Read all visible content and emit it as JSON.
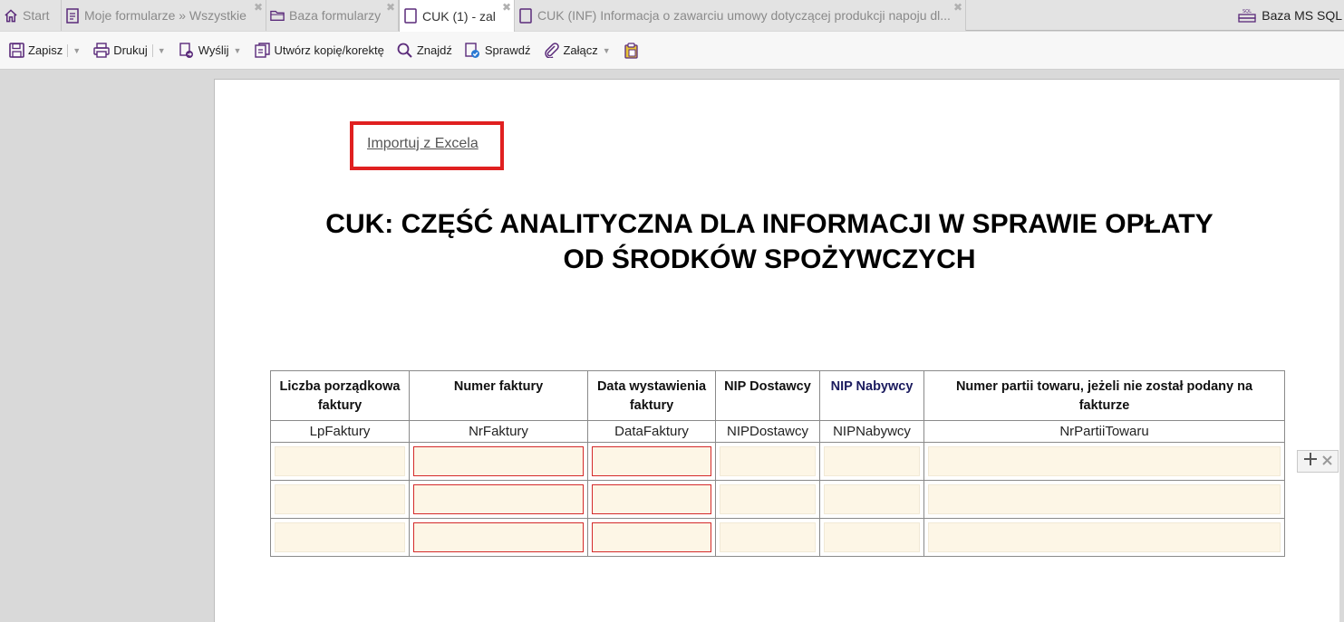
{
  "tabs": [
    {
      "label": "Start",
      "icon": "home-icon"
    },
    {
      "label": "Moje formularze » Wszystkie",
      "icon": "document-icon"
    },
    {
      "label": "Baza formularzy",
      "icon": "folder-icon"
    },
    {
      "label": "CUK (1) - zal",
      "icon": "page-icon"
    },
    {
      "label": "CUK (INF) Informacja o zawarciu umowy dotyczącej produkcji napoju dl...",
      "icon": "page-icon"
    }
  ],
  "db_tab": {
    "label": "Baza MS SQL",
    "icon": "database-icon"
  },
  "toolbar": {
    "save": "Zapisz",
    "print": "Drukuj",
    "send": "Wyślij",
    "copy": "Utwórz kopię/korektę",
    "find": "Znajdź",
    "check": "Sprawdź",
    "attach": "Załącz"
  },
  "document": {
    "import_link": "Importuj z Excela",
    "title_line1": "CUK: CZĘŚĆ ANALITYCZNA DLA INFORMACJI W SPRAWIE OPŁATY",
    "title_line2": "OD ŚRODKÓW SPOŻYWCZYCH"
  },
  "table": {
    "headers": [
      "Liczba porządkowa faktury",
      "Numer faktury",
      "Data wystawienia faktury",
      "NIP Dostawcy",
      "NIP Nabywcy",
      "Numer partii towaru, jeżeli nie został podany na fakturze"
    ],
    "tags": [
      "LpFaktury",
      "NrFaktury",
      "DataFaktury",
      "NIPDostawcy",
      "NIPNabywcy",
      "NrPartiiTowaru"
    ],
    "rows": [
      [
        "",
        "",
        "",
        "",
        "",
        ""
      ],
      [
        "",
        "",
        "",
        "",
        "",
        ""
      ],
      [
        "",
        "",
        "",
        "",
        "",
        ""
      ]
    ]
  },
  "colors": {
    "highlight_border": "#e02020",
    "required_border": "#d42a2a",
    "field_bg": "#fdf6e6",
    "icon_purple": "#5a2a7a"
  }
}
